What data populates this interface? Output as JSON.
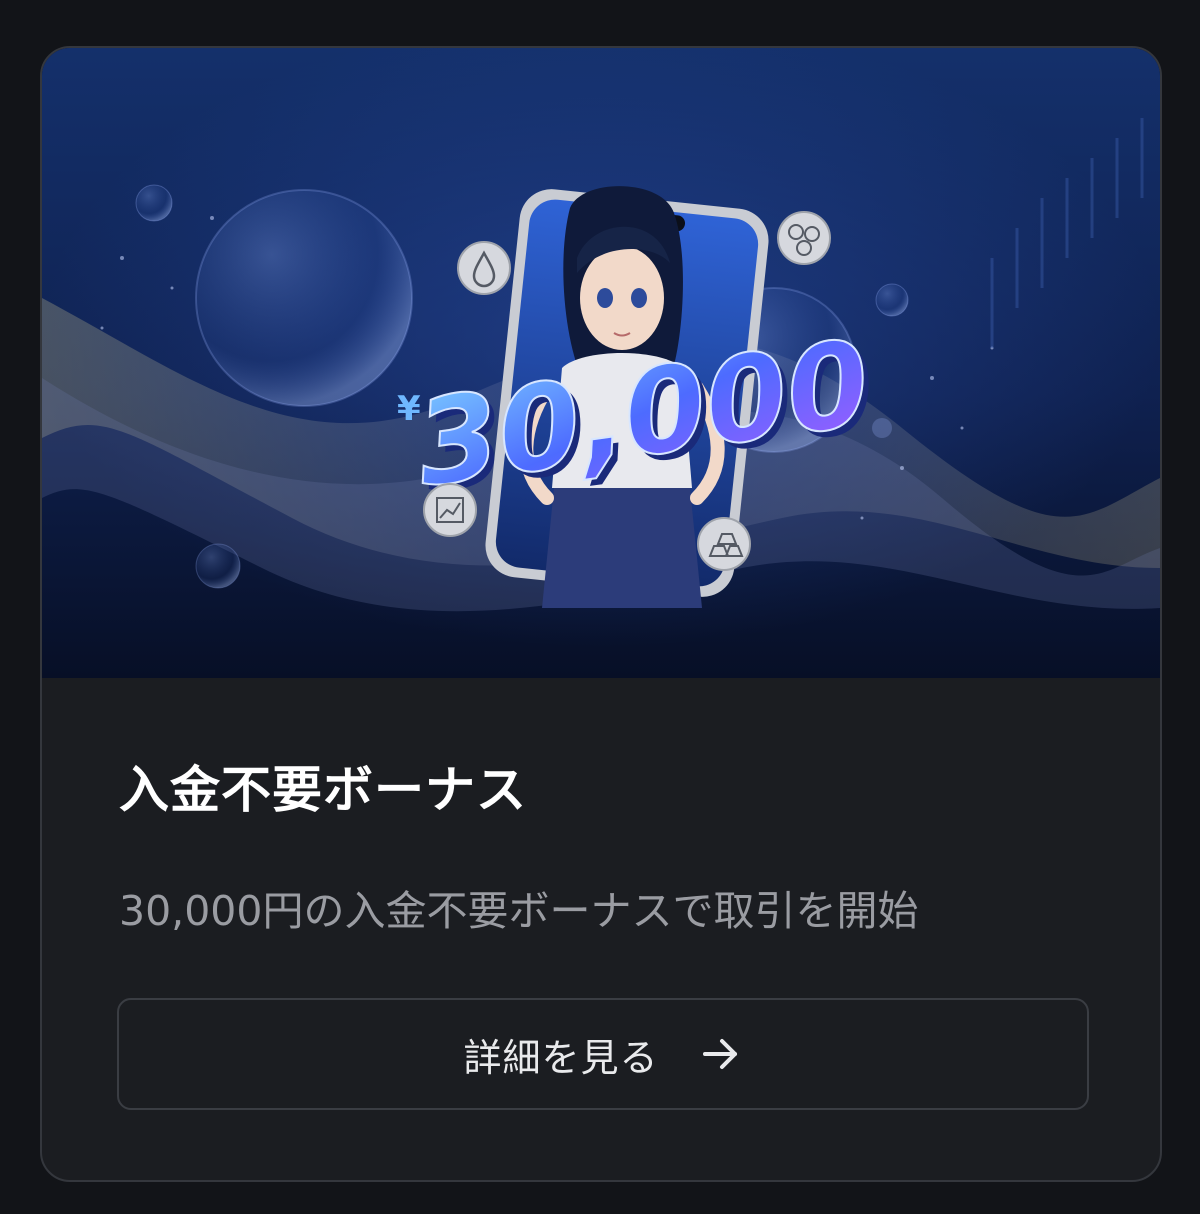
{
  "card": {
    "banner": {
      "currency_symbol": "¥",
      "amount": "30,000"
    },
    "title": "入金不要ボーナス",
    "description": "30,000円の入金不要ボーナスで取引を開始",
    "button": {
      "label": "詳細を見る",
      "icon": "arrow-right-icon"
    }
  },
  "colors": {
    "page_background": "#121418",
    "card_background": "#1b1d21",
    "card_border": "#34373d",
    "title_text": "#ffffff",
    "description_text": "#9a9ca2",
    "button_border": "#3a3d43",
    "button_text": "#e9eaec"
  }
}
